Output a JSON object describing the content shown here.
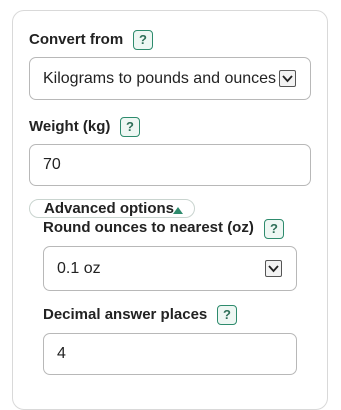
{
  "convert_from": {
    "label": "Convert from",
    "help": "?",
    "selected": "Kilograms to pounds and ounces"
  },
  "weight": {
    "label": "Weight (kg)",
    "help": "?",
    "value": "70"
  },
  "advanced": {
    "toggle_label": "Advanced options"
  },
  "round_ounces": {
    "label": "Round ounces to nearest (oz)",
    "help": "?",
    "selected": "0.1 oz"
  },
  "decimal_places": {
    "label": "Decimal answer places",
    "help": "?",
    "value": "4"
  },
  "colors": {
    "accent": "#2e8b6d",
    "border": "#b8b8b8",
    "text": "#222222"
  }
}
